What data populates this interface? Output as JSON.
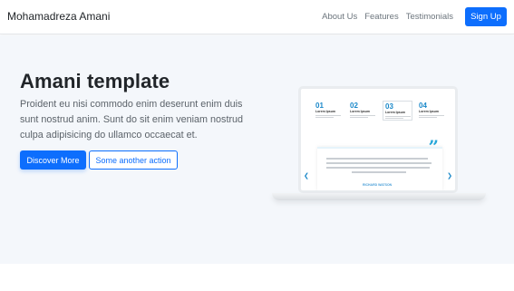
{
  "navbar": {
    "brand": "Mohamadreza Amani",
    "links": [
      {
        "label": "About Us"
      },
      {
        "label": "Features"
      },
      {
        "label": "Testimonials"
      }
    ],
    "signup_label": "Sign Up"
  },
  "hero": {
    "title": "Amani template",
    "text": "Proident eu nisi commodo enim deserunt enim duis sunt nostrud anim. Sunt do sit enim veniam nostrud culpa adipisicing do ullamco occaecat et.",
    "primary_button": "Discover More",
    "secondary_button": "Some another action"
  },
  "mockup": {
    "steps": [
      {
        "number": "01",
        "title": "Lorem Ipsum"
      },
      {
        "number": "02",
        "title": "Lorem Ipsum"
      },
      {
        "number": "03",
        "title": "Lorem Ipsum"
      },
      {
        "number": "04",
        "title": "Lorem Ipsum"
      }
    ],
    "quote_mark": "”",
    "quote_link": "RICHARD WATSON"
  },
  "colors": {
    "primary": "#0d6efd",
    "hero_bg": "#f4f7fb",
    "accent": "#26a7d9"
  }
}
